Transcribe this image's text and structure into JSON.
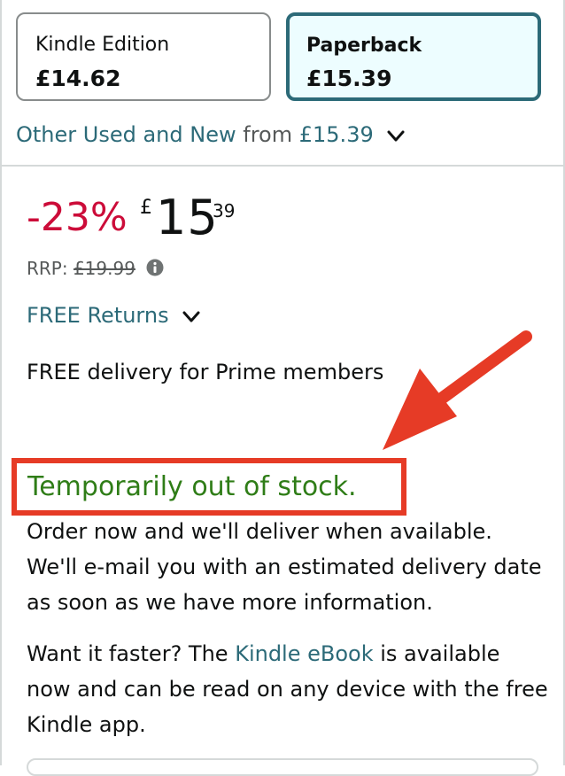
{
  "formats": {
    "kindle": {
      "name": "Kindle Edition",
      "price": "£14.62",
      "selected": false
    },
    "paperback": {
      "name": "Paperback",
      "price": "£15.39",
      "selected": true
    }
  },
  "other_offers": {
    "link": "Other Used and New",
    "from": "from",
    "price": "£15.39"
  },
  "price": {
    "discount": "-23%",
    "currency": "£",
    "whole": "15",
    "fraction": "39",
    "rrp_label": "RRP:",
    "rrp_value": "£19.99"
  },
  "returns": "FREE Returns",
  "delivery": "FREE delivery for Prime members",
  "stock": {
    "status": "Temporarily out of stock.",
    "message": "Order now and we'll deliver when available. We'll e-mail you with an estimated delivery date as soon as we have more information."
  },
  "faster": {
    "prefix": "Want it faster? The ",
    "link": "Kindle eBook",
    "suffix": " is available now and can be read on any device with the free Kindle app."
  },
  "colors": {
    "link": "#2c6a78",
    "discount": "#cc0c39",
    "in_stock_status": "#2f7d17",
    "annotation": "#e63b26",
    "selected_border": "#2c6a78",
    "selected_bg": "#edfdff"
  },
  "icons": [
    "chevron-down-icon",
    "info-icon",
    "annotation-arrow"
  ]
}
